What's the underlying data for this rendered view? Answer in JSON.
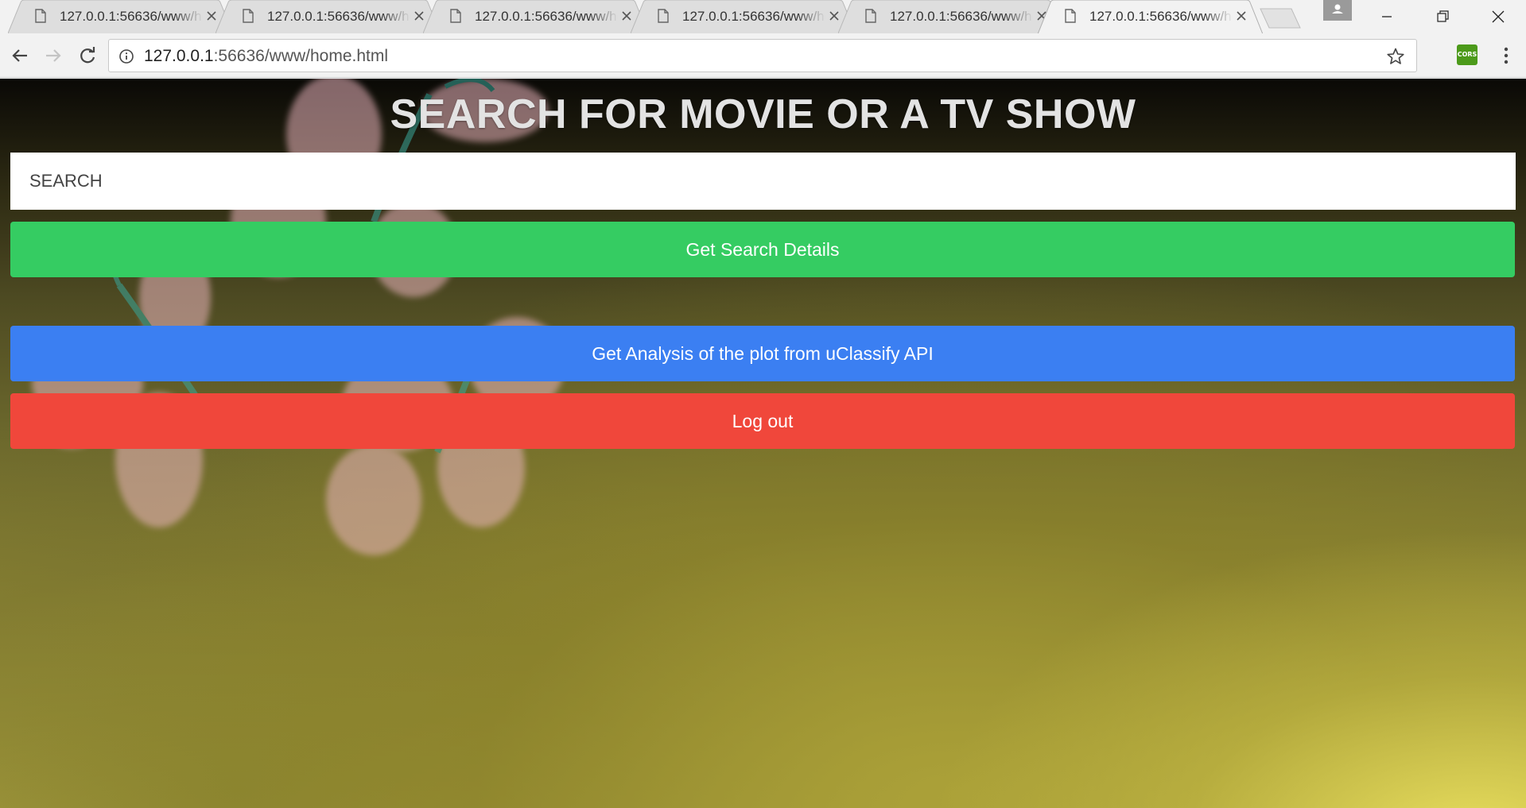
{
  "browser": {
    "tabs": [
      {
        "title": "127.0.0.1:56636/www/home.html",
        "active": false
      },
      {
        "title": "127.0.0.1:56636/www/home.html",
        "active": false
      },
      {
        "title": "127.0.0.1:56636/www/home.html",
        "active": false
      },
      {
        "title": "127.0.0.1:56636/www/home.html",
        "active": false
      },
      {
        "title": "127.0.0.1:56636/www/home.html",
        "active": false
      },
      {
        "title": "127.0.0.1:56636/www/home.html",
        "active": true
      }
    ],
    "address": {
      "host": "127.0.0.1",
      "rest": ":56636/www/home.html"
    },
    "extension_label": "CORS"
  },
  "page": {
    "title": "SEARCH FOR MOVIE OR A TV SHOW",
    "search": {
      "placeholder": "SEARCH",
      "value": ""
    },
    "buttons": {
      "search_details": "Get Search Details",
      "analysis": "Get Analysis of the plot from uClassify API",
      "logout": "Log out"
    }
  },
  "colors": {
    "green_button": "#35cc62",
    "blue_button": "#3b7ff2",
    "red_button": "#f0473b"
  },
  "icons": [
    "page-icon",
    "close-icon",
    "profile-icon",
    "minimize-icon",
    "restore-icon",
    "window-close-icon",
    "back-arrow-icon",
    "forward-arrow-icon",
    "reload-icon",
    "info-icon",
    "star-icon",
    "more-vert-icon"
  ]
}
